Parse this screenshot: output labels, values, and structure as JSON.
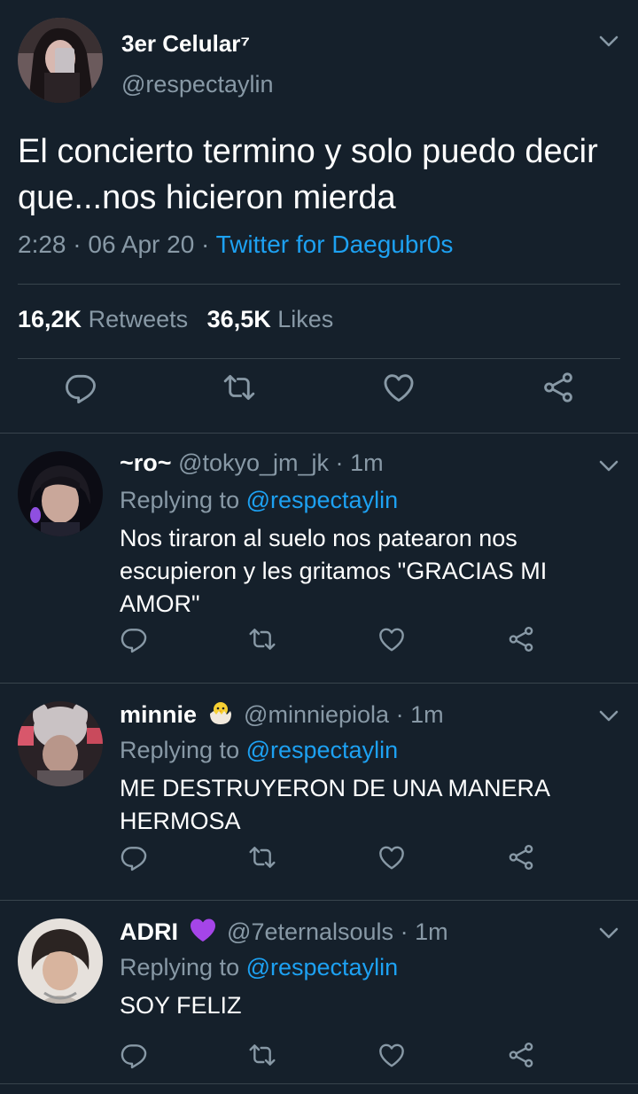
{
  "main_tweet": {
    "name": "3er Celular⁷",
    "handle": "@respectaylin",
    "text": "El concierto termino y solo puedo decir que...nos hicieron mierda",
    "time": "2:28",
    "date": "06 Apr 20",
    "sep": "·",
    "source": "Twitter for Daegubr0s",
    "retweets_count": "16,2K",
    "retweets_label": "Retweets",
    "likes_count": "36,5K",
    "likes_label": "Likes"
  },
  "replies": [
    {
      "name": "~ro~",
      "handle": "@tokyo_jm_jk",
      "time": "1m",
      "replying_label": "Replying to",
      "replying_to": "@respectaylin",
      "text": "Nos tiraron al suelo nos patearon nos escupieron y les gritamos \"GRACIAS MI AMOR\""
    },
    {
      "name": "minnie",
      "handle": "@minniepiola",
      "time": "1m",
      "replying_label": "Replying to",
      "replying_to": "@respectaylin",
      "text": "ME DESTRUYERON DE UNA MANERA HERMOSA"
    },
    {
      "name": "ADRI",
      "handle": "@7eternalsouls",
      "time": "1m",
      "replying_label": "Replying to",
      "replying_to": "@respectaylin",
      "text": "SOY FELIZ"
    }
  ],
  "colors": {
    "background": "#15202b",
    "divider": "#38444d",
    "secondary_text": "#8899a6",
    "link": "#1da1f2",
    "heart_emoji": "#a545e8",
    "chick_emoji": "#f7d033"
  },
  "icons": [
    "chevron-down-icon",
    "reply-icon",
    "retweet-icon",
    "like-icon",
    "share-icon",
    "hatching-chick-emoji",
    "purple-heart-emoji"
  ]
}
